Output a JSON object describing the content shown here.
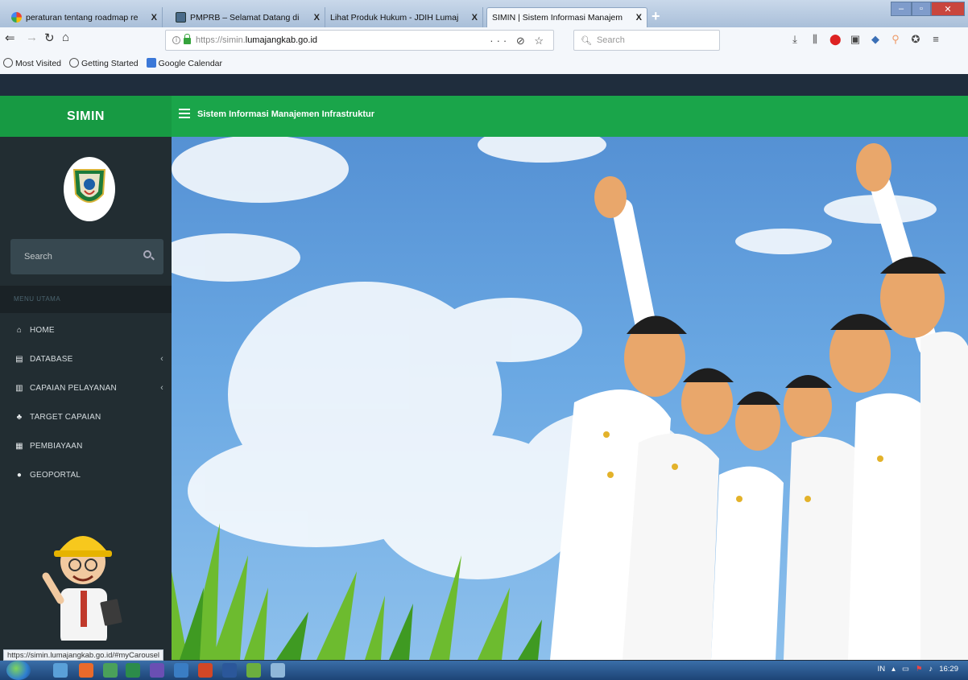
{
  "browser": {
    "tabs": [
      {
        "title": "peraturan tentang roadmap re",
        "active": false,
        "icon": "google-icon"
      },
      {
        "title": "PMPRB – Selamat Datang di",
        "active": false,
        "icon": "pmprb-icon"
      },
      {
        "title": "Lihat Produk Hukum - JDIH Lumaj",
        "active": false,
        "icon": "none"
      },
      {
        "title": "SIMIN | Sistem Informasi Manajem",
        "active": true,
        "icon": "none"
      }
    ],
    "close_glyph": "X",
    "new_tab_glyph": "+",
    "url_prefix": "https://simin.",
    "url_domain": "lumajangkab.go.id",
    "url_actions": "··· ⊘ ☆",
    "search_placeholder": "Search",
    "bookmarks": [
      {
        "label": "Most Visited",
        "icon": "gear-icon"
      },
      {
        "label": "Getting Started",
        "icon": "firefox-icon"
      },
      {
        "label": "Google Calendar",
        "icon": "calendar-icon"
      }
    ],
    "status_url": "https://simin.lumajangkab.go.id/#myCarousel"
  },
  "site": {
    "brand": "SIMIN",
    "title": "Sistem Informasi Manajemen Infrastruktur",
    "accent_color": "#1aa54a",
    "sidebar_color": "#222d32"
  },
  "sidebar": {
    "search_placeholder": "Search",
    "menu_header": "MENU UTAMA",
    "items": [
      {
        "label": "HOME",
        "icon": "home-icon",
        "glyph": "⌂",
        "has_submenu": false
      },
      {
        "label": "DATABASE",
        "icon": "database-icon",
        "glyph": "▤",
        "has_submenu": true
      },
      {
        "label": "CAPAIAN PELAYANAN",
        "icon": "chart-icon",
        "glyph": "▥",
        "has_submenu": true
      },
      {
        "label": "TARGET CAPAIAN",
        "icon": "users-icon",
        "glyph": "♣",
        "has_submenu": false
      },
      {
        "label": "PEMBIAYAAN",
        "icon": "table-icon",
        "glyph": "▦",
        "has_submenu": false
      },
      {
        "label": "GEOPORTAL",
        "icon": "globe-icon",
        "glyph": "●",
        "has_submenu": false
      }
    ]
  },
  "taskbar": {
    "time": "16:29",
    "language": "IN"
  }
}
